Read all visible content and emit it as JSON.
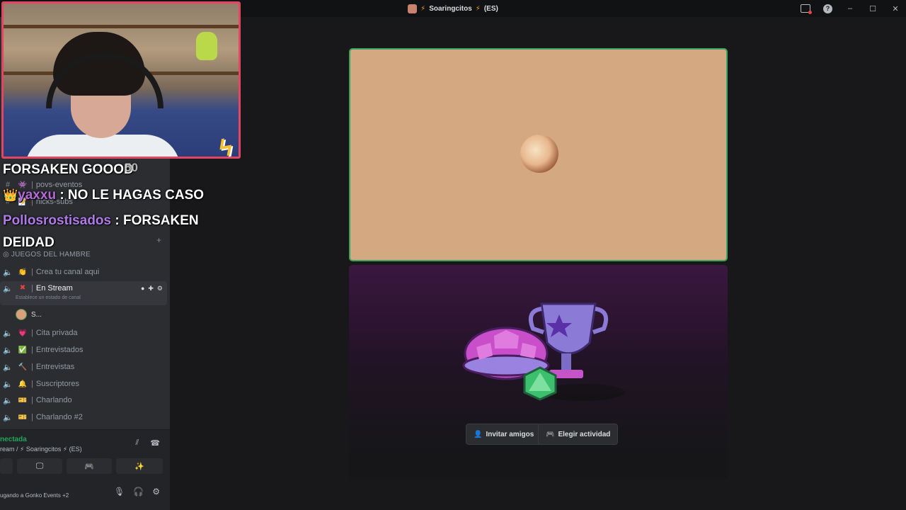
{
  "titlebar": {
    "server_name": "Soaringcitos",
    "region": "(ES)"
  },
  "sidebar": {
    "channels_top": [
      {
        "name": "povs-eventos",
        "type": "text"
      },
      {
        "name": "nicks-subs",
        "type": "text"
      }
    ],
    "category": "JUEGOS DEL HAMBRE",
    "voice_channels": [
      {
        "emoji": "👏",
        "name": "Crea tu canal aqui"
      },
      {
        "emoji": "✖",
        "name": "En Stream",
        "active": true,
        "status_hint": "Establece un estado de canal"
      },
      {
        "emoji": "💗",
        "name": "Cita privada"
      },
      {
        "emoji": "✅",
        "name": "Entrevistados"
      },
      {
        "emoji": "🔨",
        "name": "Entrevistas"
      },
      {
        "emoji": "🔔",
        "name": "Suscriptores"
      },
      {
        "emoji": "🎫",
        "name": "Charlando"
      },
      {
        "emoji": "🎫",
        "name": "Charlando #2"
      }
    ],
    "connected_user": "S..."
  },
  "voice_panel": {
    "status": "nectada",
    "location": "ream /  ⚡ Soaringcitos ⚡ (ES)"
  },
  "user_panel": {
    "activity": "ugando a Gonko Events +2"
  },
  "main": {
    "buttons": {
      "invite": "Invitar amigos",
      "activity": "Elegir actividad"
    }
  },
  "overlay_chat": {
    "line1": "FORSAKEN GOOOD",
    "counter": "50",
    "user1": "yaxxu",
    "msg1": ": NO LE HAGAS CASO",
    "user2": "Pollosrostisados",
    "msg2": ": FORSAKEN",
    "msg2b": "DEIDAD"
  },
  "colors": {
    "accent_green": "#23a55a",
    "tile_border": "#3aa55d",
    "webcam_border": "#e24662"
  }
}
